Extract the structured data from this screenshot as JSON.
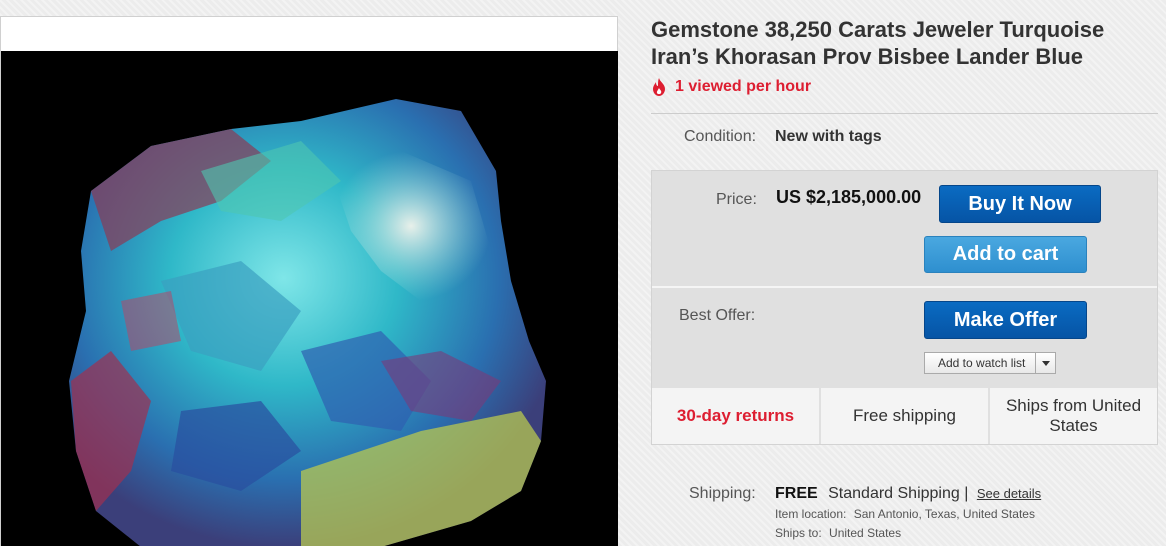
{
  "listing": {
    "title": "Gemstone 38,250 Carats Jeweler Turquoise Iran’s Khorasan Prov Bisbee Lander Blue",
    "viewed": "1 viewed per hour",
    "condition_label": "Condition:",
    "condition_value": "New with tags"
  },
  "buybox": {
    "price_label": "Price:",
    "price_value": "US $2,185,000.00",
    "buy_now": "Buy It Now",
    "add_to_cart": "Add to cart",
    "best_offer_label": "Best Offer:",
    "make_offer": "Make Offer",
    "watch_list": "Add to watch list",
    "features": [
      "30-day returns",
      "Free shipping",
      "Ships from United States"
    ]
  },
  "shipping": {
    "label": "Shipping:",
    "free": "FREE",
    "method": "Standard Shipping |",
    "details_link": "See details",
    "location_label": "Item location:",
    "location_value": "San Antonio, Texas, United States",
    "ships_to_label": "Ships to:",
    "ships_to_value": "United States"
  },
  "colors": {
    "accent_red": "#dd1e31",
    "button_blue": "#0654a5",
    "button_light_blue": "#2e8fcf"
  },
  "icons": {
    "viewed": "flame-icon",
    "watch_dropdown": "chevron-down-icon"
  }
}
